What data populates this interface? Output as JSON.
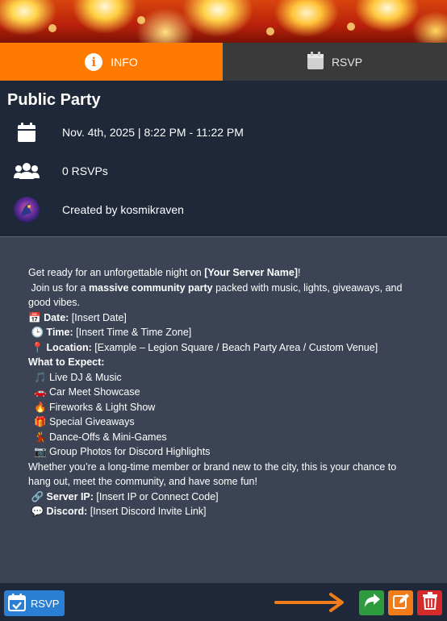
{
  "tabs": {
    "info_label": "INFO",
    "rsvp_label": "RSVP"
  },
  "event": {
    "title": "Public Party",
    "datetime": "Nov. 4th, 2025 | 8:22 PM - 11:22 PM",
    "rsvp_count": "0 RSVPs",
    "created_by": "Created by kosmikraven"
  },
  "description": {
    "intro_pre": "Get ready for an unforgettable night on ",
    "intro_bold": "[Your Server Name]",
    "intro_post": "!",
    "join_pre": " Join us for a ",
    "join_bold": "massive community party",
    "join_post": " packed with music, lights, giveaways, and good vibes.",
    "date_icon": "📅",
    "date_label": "Date:",
    "date_value": " [Insert Date]",
    "time_icon": "🕒",
    "time_label": "Time:",
    "time_value": " [Insert Time & Time Zone]",
    "location_icon": "📍",
    "location_label": "Location:",
    "location_value": " [Example – Legion Square / Beach Party Area / Custom Venue]",
    "expect_heading": "What to Expect:",
    "expect_items": [
      {
        "icon": "🎵",
        "text": "Live DJ & Music"
      },
      {
        "icon": "🚗",
        "text": "Car Meet Showcase"
      },
      {
        "icon": "🔥",
        "text": "Fireworks & Light Show"
      },
      {
        "icon": "🎁",
        "text": "Special Giveaways"
      },
      {
        "icon": "💃",
        "text": "Dance-Offs & Mini-Games"
      },
      {
        "icon": "📷",
        "text": "Group Photos for Discord Highlights"
      }
    ],
    "closing": "Whether you’re a long-time member or brand new to the city, this is your chance to hang out, meet the community, and have some fun!",
    "server_icon": "🔗",
    "server_label": "Server IP:",
    "server_value": " [Insert IP or Connect Code]",
    "discord_icon": "💬",
    "discord_label": "Discord:",
    "discord_value": " [Insert Discord Invite Link]"
  },
  "footer": {
    "rsvp_button": "RSVP"
  },
  "colors": {
    "accent": "#ff7a00",
    "panel": "#1e2838",
    "body": "#3b4354",
    "share": "#2e9b3e",
    "edit": "#f07d1a",
    "delete": "#d62b2b",
    "rsvp": "#2a7fd4"
  },
  "icons": [
    "info-icon",
    "calendar-icon",
    "users-icon",
    "avatar",
    "calendar-check-icon",
    "share-icon",
    "edit-icon",
    "trash-icon",
    "arrow-right-icon"
  ]
}
